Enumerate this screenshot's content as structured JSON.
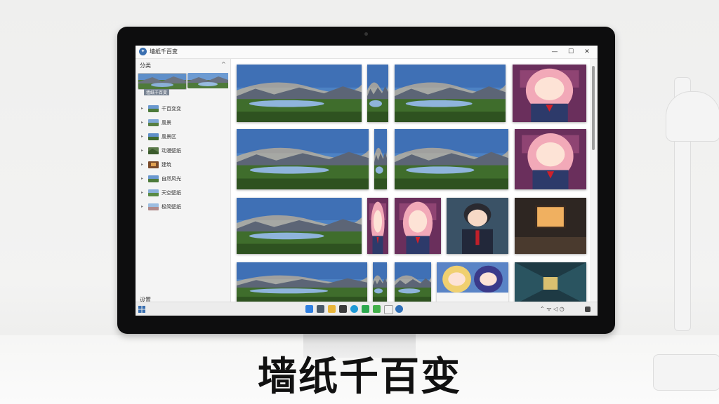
{
  "window": {
    "title": "墙纸千百变"
  },
  "window_controls": {
    "minimize": "—",
    "maximize": "☐",
    "close": "✕"
  },
  "sidebar": {
    "header": "分类",
    "collapse": "^",
    "featured_label": "墙纸千百变",
    "items": [
      {
        "label": "千百变变",
        "thumb": "landscape"
      },
      {
        "label": "風景",
        "thumb": "landscape"
      },
      {
        "label": "風景区",
        "thumb": "landscape"
      },
      {
        "label": "动漫壁纸",
        "thumb": "mountain"
      },
      {
        "label": "建筑",
        "thumb": "room"
      },
      {
        "label": "自然风光",
        "thumb": "landscape"
      },
      {
        "label": "天空壁纸",
        "thumb": "landscape"
      },
      {
        "label": "极简壁纸",
        "thumb": "landscape"
      }
    ],
    "footer": "设置"
  },
  "gallery": {
    "tiles": [
      {
        "kind": "landscape"
      },
      {
        "kind": "landscape"
      },
      {
        "kind": "landscape"
      },
      {
        "kind": "anime-girl"
      },
      {
        "kind": "landscape"
      },
      {
        "kind": "landscape"
      },
      {
        "kind": "landscape"
      },
      {
        "kind": "anime-girl"
      },
      {
        "kind": "landscape"
      },
      {
        "kind": "anime-girl"
      },
      {
        "kind": "anime-girl"
      },
      {
        "kind": "anime-boy"
      },
      {
        "kind": "room"
      },
      {
        "kind": "landscape"
      },
      {
        "kind": "landscape"
      },
      {
        "kind": "landscape"
      },
      {
        "kind": "anime-duo"
      },
      {
        "kind": "corridor"
      }
    ]
  },
  "taskbar": {
    "icons": [
      "windows-icon",
      "file-explorer-icon",
      "folder-icon",
      "mail-icon",
      "edge-icon",
      "chat-icon",
      "photos-icon",
      "store-icon",
      "settings-icon"
    ],
    "tray": "⌃ ᯤ ◁ ◷"
  },
  "caption": "墙纸千百变",
  "colors": {
    "accent": "#3a6fb0",
    "sky": "#4a7fc0",
    "grass": "#3c6a2a",
    "anime-bg": "#8a3a6a"
  }
}
